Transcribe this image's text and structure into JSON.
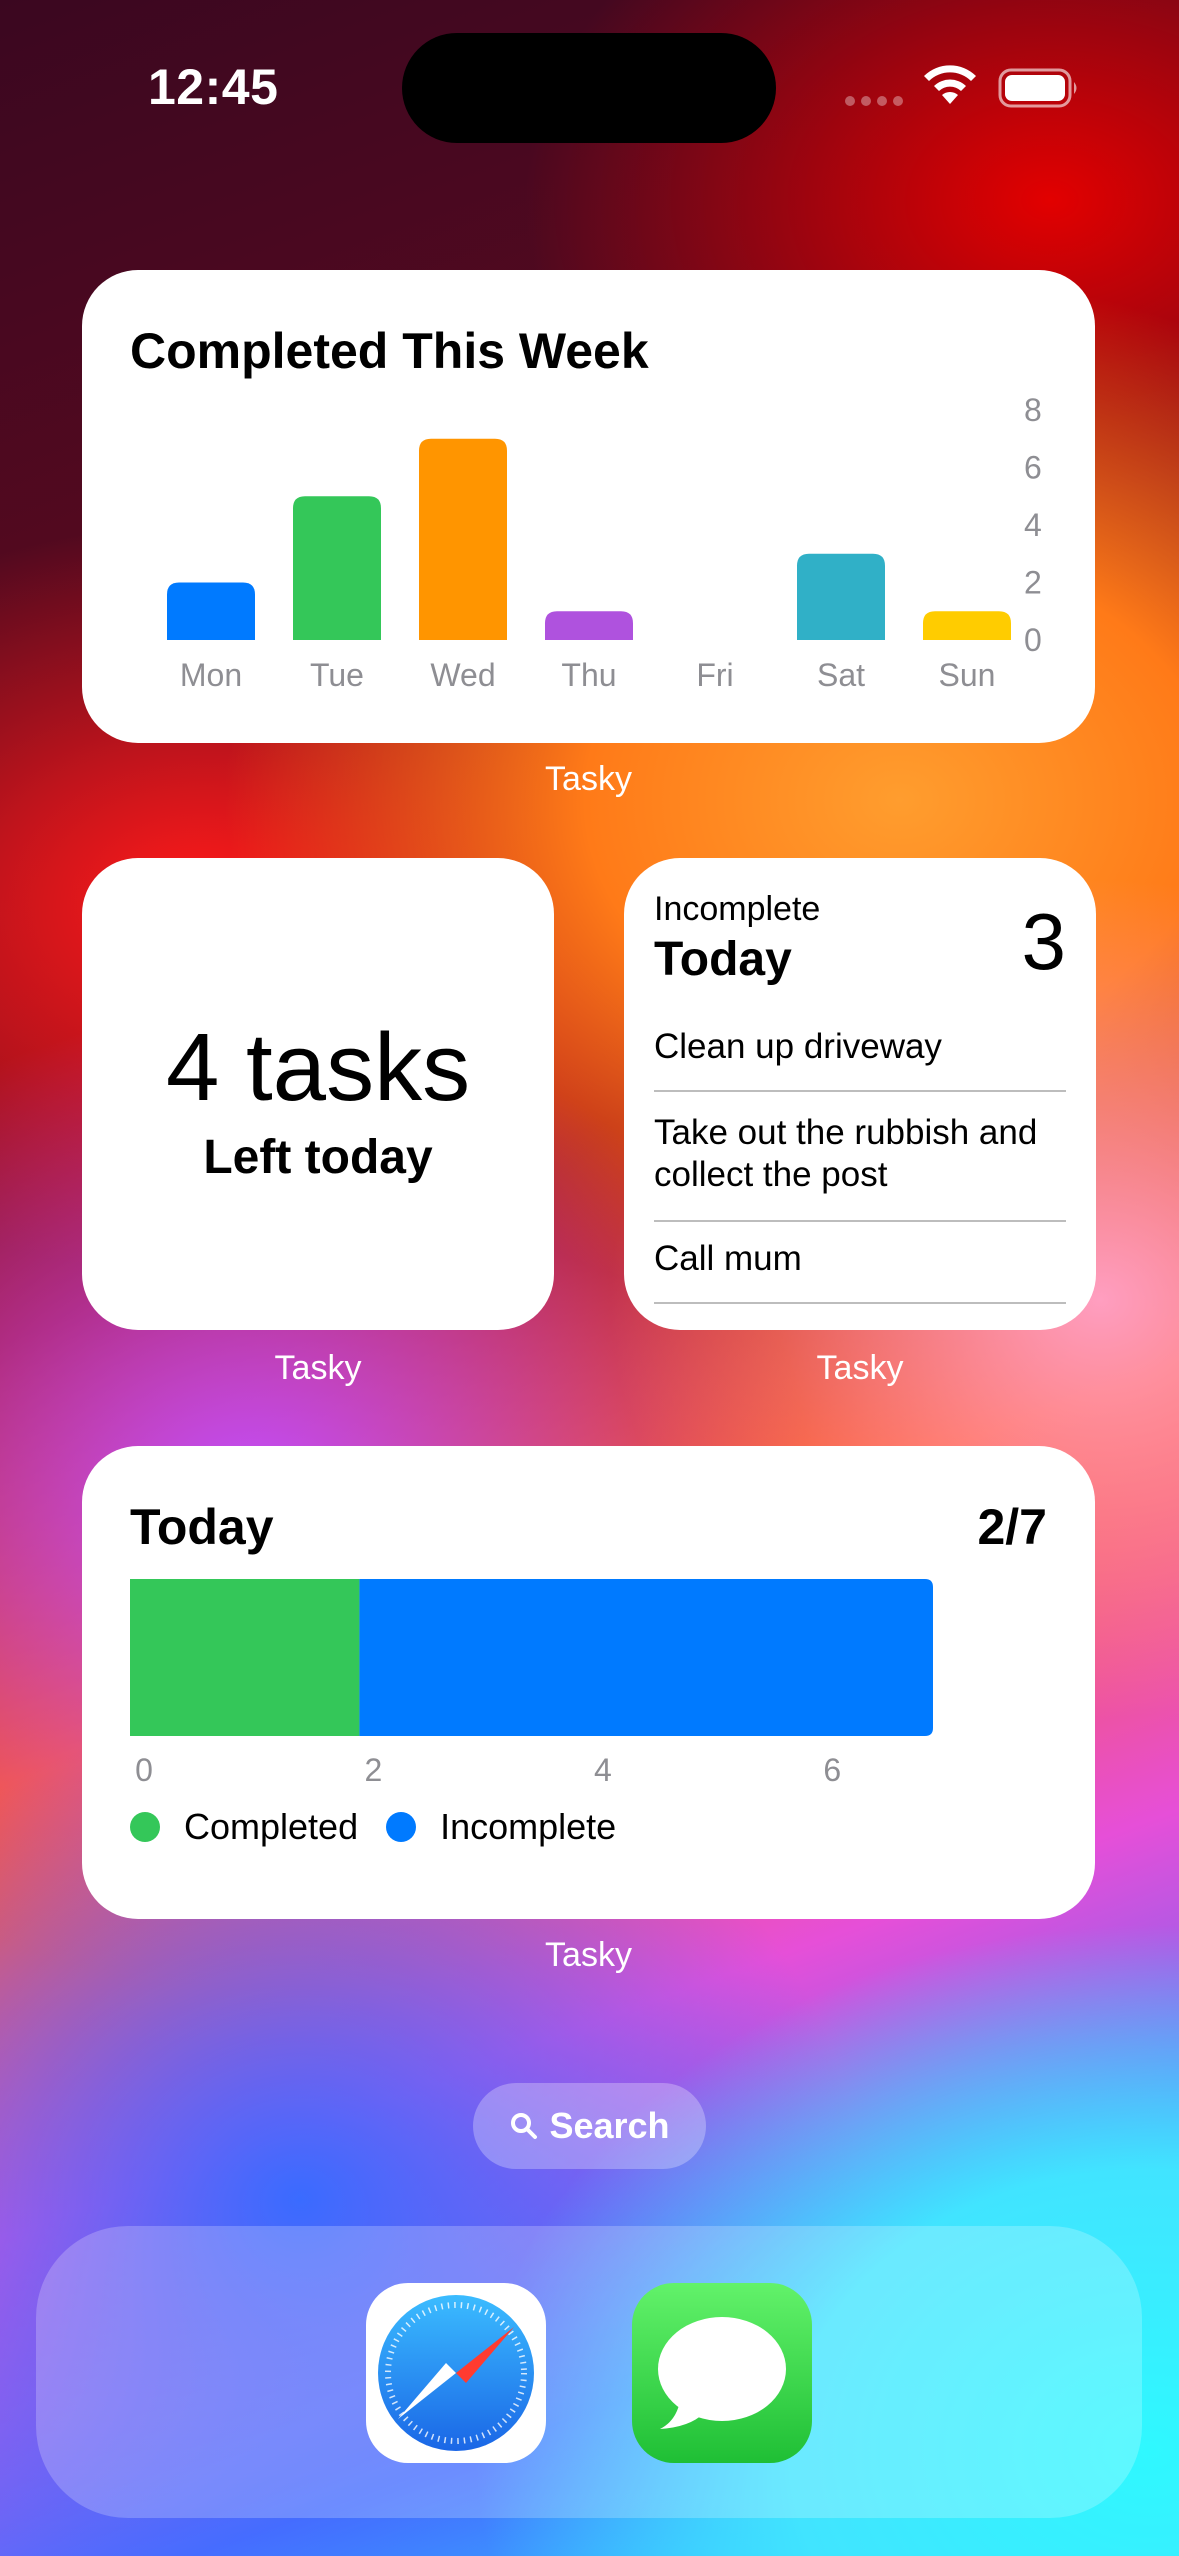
{
  "status_bar": {
    "time": "12:45"
  },
  "week_widget": {
    "title": "Completed This Week",
    "caption": "Tasky",
    "chart_data": {
      "type": "bar",
      "title": "Completed This Week",
      "categories": [
        "Mon",
        "Tue",
        "Wed",
        "Thu",
        "Fri",
        "Sat",
        "Sun"
      ],
      "values": [
        2,
        5,
        7,
        1,
        0,
        3,
        1
      ],
      "colors": [
        "#007AFF",
        "#34C759",
        "#FF9500",
        "#AF52DE",
        "#8E8E93",
        "#30B0C7",
        "#FFCC00"
      ],
      "yticks": [
        0,
        2,
        4,
        6,
        8
      ],
      "ylim": [
        0,
        8
      ],
      "ylabel": "",
      "xlabel": "",
      "grid": false
    }
  },
  "tasks_left_widget": {
    "count_text": "4 tasks",
    "subtitle": "Left today",
    "caption": "Tasky"
  },
  "incomplete_widget": {
    "label": "Incomplete",
    "heading": "Today",
    "count": "3",
    "items": [
      "Clean up driveway",
      "Take out the rubbish and collect the post",
      "Call mum"
    ],
    "caption": "Tasky"
  },
  "today_widget": {
    "title": "Today",
    "ratio": "2/7",
    "caption": "Tasky",
    "legend": [
      "Completed",
      "Incomplete"
    ],
    "chart_data": {
      "type": "bar",
      "orientation": "horizontal-stacked",
      "series": [
        {
          "name": "Completed",
          "values": [
            2
          ],
          "color": "#34C759"
        },
        {
          "name": "Incomplete",
          "values": [
            5
          ],
          "color": "#007AFF"
        }
      ],
      "xticks": [
        0,
        2,
        4,
        6
      ],
      "xlim": [
        0,
        7
      ],
      "legend_position": "bottom-left"
    }
  },
  "search": {
    "label": "Search"
  },
  "dock": {
    "apps": [
      "Safari",
      "Messages"
    ]
  }
}
